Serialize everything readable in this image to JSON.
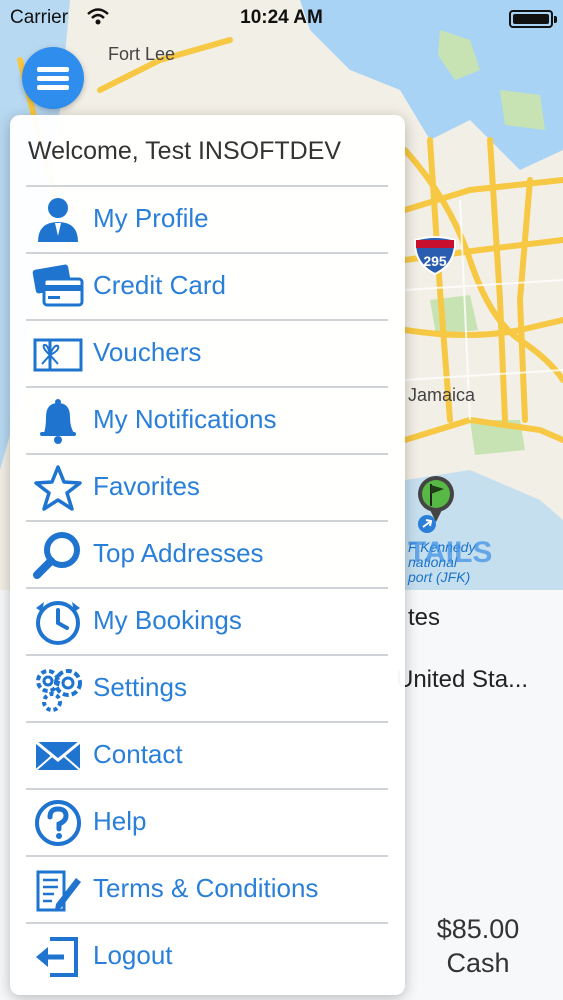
{
  "status_bar": {
    "carrier": "Carrier",
    "time": "10:24 AM"
  },
  "map": {
    "labels": {
      "fort_lee": "Fort Lee",
      "jamaica": "Jamaica",
      "interstate": "295",
      "airport": "F Kennedy\nnational\nport (JFK)",
      "details": "TAILS"
    }
  },
  "booking": {
    "pickup": "tes",
    "dropoff": "United Sta...",
    "price_amount": "$85.00",
    "payment_method": "Cash"
  },
  "menu": {
    "welcome": "Welcome, Test INSOFTDEV",
    "items": [
      {
        "label": "My Profile",
        "icon": "user-icon"
      },
      {
        "label": "Credit Card",
        "icon": "credit-card-icon"
      },
      {
        "label": "Vouchers",
        "icon": "voucher-icon"
      },
      {
        "label": "My Notifications",
        "icon": "bell-icon"
      },
      {
        "label": "Favorites",
        "icon": "star-icon"
      },
      {
        "label": "Top Addresses",
        "icon": "magnifier-icon"
      },
      {
        "label": "My Bookings",
        "icon": "clock-icon"
      },
      {
        "label": "Settings",
        "icon": "gears-icon"
      },
      {
        "label": "Contact",
        "icon": "envelope-icon"
      },
      {
        "label": "Help",
        "icon": "question-icon"
      },
      {
        "label": "Terms & Conditions",
        "icon": "document-pen-icon"
      },
      {
        "label": "Logout",
        "icon": "logout-icon"
      }
    ]
  },
  "colors": {
    "accent": "#2f8ded",
    "menu_text": "#2a7fd8",
    "divider": "#cfd3d8"
  }
}
